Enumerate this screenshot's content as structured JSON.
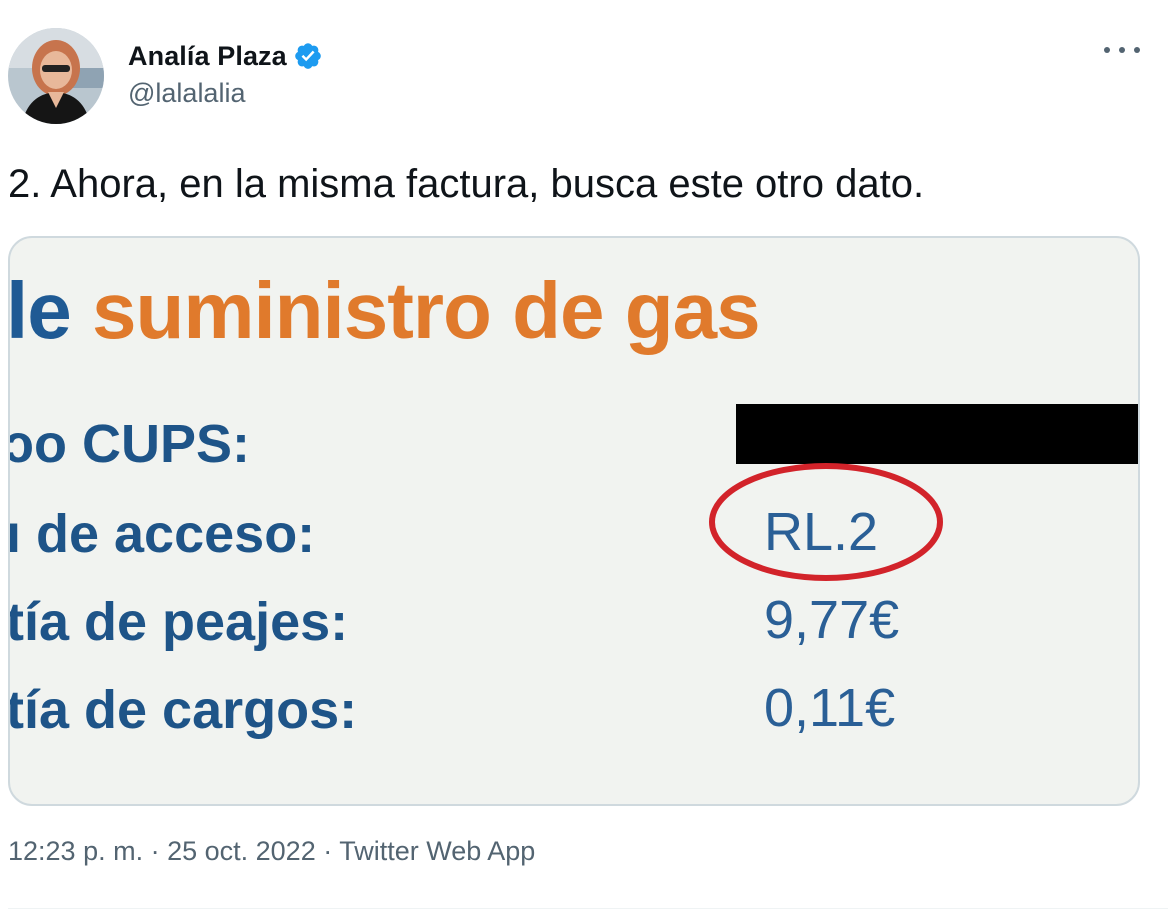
{
  "author": {
    "display_name": "Analía Plaza",
    "handle": "@lalalalia",
    "verified": true,
    "avatar_icon": "user-avatar-photo"
  },
  "tweet": {
    "text": "2. Ahora, en la misma factura, busca este otro dato."
  },
  "media": {
    "title_part1": "le ",
    "title_part2": "suministro de gas",
    "rows": [
      {
        "label": "ɔo CUPS:",
        "value": ""
      },
      {
        "label": "ı de acceso:",
        "value": "RL.2"
      },
      {
        "label": "tía de peajes:",
        "value": "9,77€"
      },
      {
        "label": "tía de cargos:",
        "value": "0,11€"
      }
    ],
    "colors": {
      "title_blue": "#1f5a94",
      "title_orange": "#e07a2c",
      "label_blue": "#1e5488",
      "highlight_red": "#d2232a"
    }
  },
  "meta": {
    "time": "12:23 p. m.",
    "separator": " · ",
    "date": "25 oct. 2022",
    "app": "Twitter Web App"
  },
  "icons": {
    "verified": "verified-badge-icon",
    "more": "more-options-icon"
  }
}
